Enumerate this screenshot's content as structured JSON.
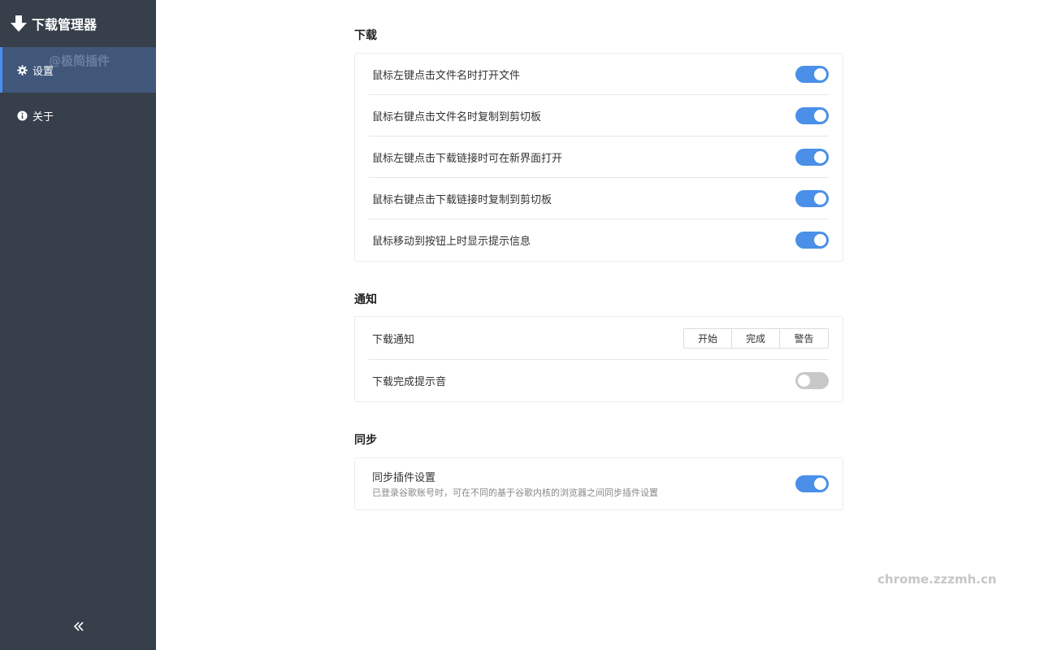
{
  "sidebar": {
    "app_title": "下载管理器",
    "logo_icon": "download-arrow-icon",
    "items": [
      {
        "label": "设置",
        "icon": "gear-icon",
        "active": true
      },
      {
        "label": "关于",
        "icon": "info-icon",
        "active": false
      }
    ],
    "watermark": "@极简插件",
    "collapse_icon": "double-chevron-left-icon"
  },
  "sections": {
    "download": {
      "title": "下载",
      "rows": [
        {
          "label": "鼠标左键点击文件名时打开文件",
          "enabled": true
        },
        {
          "label": "鼠标右键点击文件名时复制到剪切板",
          "enabled": true
        },
        {
          "label": "鼠标左键点击下载链接时可在新界面打开",
          "enabled": true
        },
        {
          "label": "鼠标右键点击下载链接时复制到剪切板",
          "enabled": true
        },
        {
          "label": "鼠标移动到按钮上时显示提示信息",
          "enabled": true
        }
      ]
    },
    "notify": {
      "title": "通知",
      "download_notify_label": "下载通知",
      "segments": [
        "开始",
        "完成",
        "警告"
      ],
      "sound_label": "下载完成提示音",
      "sound_enabled": false
    },
    "sync": {
      "title": "同步",
      "label": "同步插件设置",
      "sub": "已登录谷歌账号时，可在不同的基于谷歌内核的浏览器之间同步插件设置",
      "enabled": true
    }
  },
  "watermark": "chrome.zzzmh.cn",
  "colors": {
    "sidebar_bg": "#363f4a",
    "active_bg": "#41577a",
    "accent": "#4a90e8",
    "toggle_off": "#c8c8c8"
  }
}
